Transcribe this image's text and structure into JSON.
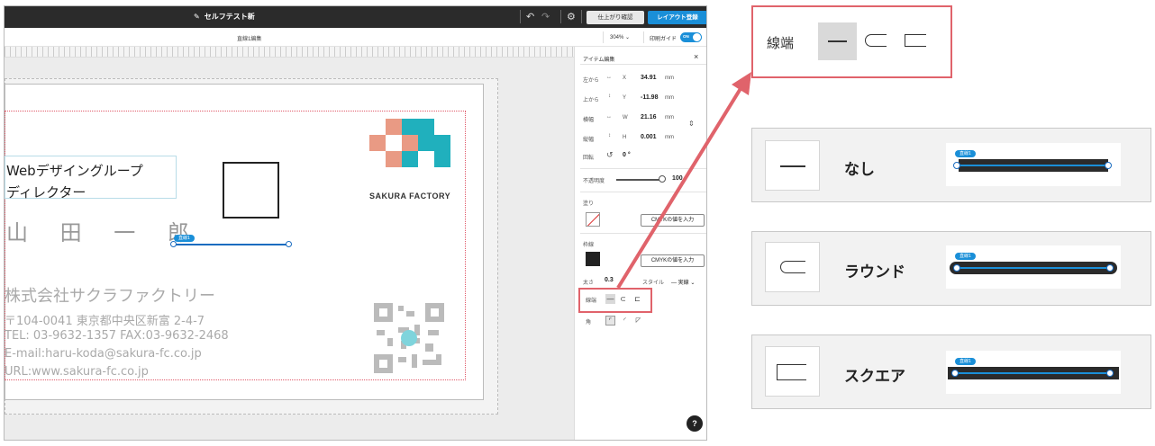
{
  "app": {
    "title": "セルフテスト新",
    "preview_button": "仕上がり確認",
    "register_button": "レイアウト登録"
  },
  "subbar": {
    "item_name": "直線1編集",
    "zoom": "304%",
    "guide_label": "印刷ガイド",
    "guide_toggle": "ON"
  },
  "card": {
    "department": "Webデザイングループ",
    "role": "ディレクター",
    "name": "山 田 一 郎",
    "company": "株式会社サクラファクトリー",
    "address": "〒104-0041 東京都中央区新富 2-4-7",
    "tel": "TEL: 03-9632-1357 FAX:03-9632-2468",
    "email": "E-mail:haru-koda@sakura-fc.co.jp",
    "url": "URL:www.sakura-fc.co.jp",
    "logo_text": "SAKURA FACTORY",
    "line_tag": "直線1"
  },
  "panel": {
    "title": "アイテム編集",
    "close": "×",
    "rows": [
      {
        "label": "左から",
        "axis": "X",
        "value": "34.91",
        "unit": "mm"
      },
      {
        "label": "上から",
        "axis": "Y",
        "value": "-11.98",
        "unit": "mm"
      },
      {
        "label": "横幅",
        "axis": "W",
        "value": "21.16",
        "unit": "mm"
      },
      {
        "label": "縦幅",
        "axis": "H",
        "value": "0.001",
        "unit": "mm"
      }
    ],
    "rotation_label": "回転",
    "rotation_value": "0 °",
    "opacity_label": "不透明度",
    "opacity_value": "100",
    "fill_label": "塗り",
    "fill_cmyk": "CMYKの値を入力",
    "stroke_label": "枠線",
    "stroke_cmyk": "CMYKの値を入力",
    "thickness_label": "太さ",
    "thickness_value": "0.3",
    "style_label": "スタイル",
    "style_value": "— 実線",
    "cap_label": "線端",
    "corner_label": "角",
    "help": "?"
  },
  "callout": {
    "label": "線端"
  },
  "options": [
    {
      "label": "なし",
      "tag": "直線1"
    },
    {
      "label": "ラウンド",
      "tag": "直線1"
    },
    {
      "label": "スクエア",
      "tag": "直線1"
    }
  ],
  "colors": {
    "accent": "#1a8fd8",
    "highlight": "#e0636b",
    "topbar": "#2b2b2b"
  }
}
